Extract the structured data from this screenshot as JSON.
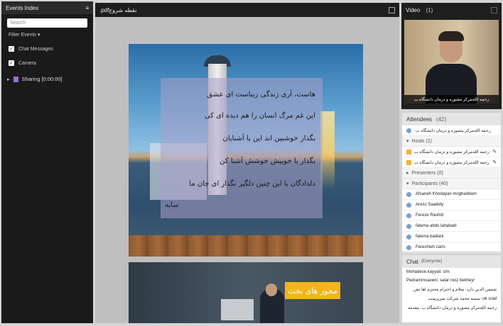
{
  "events_panel": {
    "title": "Events Index",
    "menu_icon": "menu-icon",
    "search_placeholder": "Search",
    "filter_label": "Filter Events",
    "chat_messages_label": "Chat Messages",
    "camera_label": "Camera",
    "sharing_label": "Sharing [0:00:00]"
  },
  "presentation": {
    "title": ".pdfنقطه شروع",
    "poem_lines": [
      "هاست، آری زندگی زیباست ای عشق",
      "این غم مرگ انسان را هم دیده ای کی",
      "بگذار خوشبین اند این با آشنایان",
      "بگذار با خوبیش خوشش آشنا کن",
      "دلدادگان با این چنین دلگیر نگذار ای جان ما",
      "سایه"
    ],
    "slide2_label": "محور های بحث"
  },
  "video": {
    "title": "Video",
    "count": "(1)",
    "caption": "رحمه الله‌مرکز مشوره و درمان دانشگاه ب"
  },
  "attendees": {
    "title": "Attendees",
    "count": "(42)",
    "self": "رحمه الله‌مرکز مشوره و درمان دانشگاه ب",
    "hosts_label": "Hosts (2)",
    "hosts": [
      "رحمه الله‌مرکز مشوره و درمان دانشگاه ب",
      "رحمه الله‌مرکز مشوره و درمان دانشگاه ب"
    ],
    "presenters_label": "Presenters (0)",
    "participants_label": "Participants (40)",
    "participants": [
      "Afsaneh Khodayari moghaddam",
      "Arezu Saadety",
      "Fereze Rashid",
      "fatema abdo lahabadi",
      "fatema badiani",
      "Fereshteh zarin"
    ]
  },
  "chat": {
    "title": "Chat",
    "scope": "(Everyone)",
    "lines": [
      "Mohadese.kayyali: sim",
      "Pedrammoaveni: salar rooz bekheyr",
      "شمس الدین دارد: سلام و احترام محترم اها تش",
      "ok srad: سمیه محمد شرکت سرپرست",
      "رحمه الله‌مرکز مشوره و درمان دانشگاه ب: مقدمه"
    ]
  }
}
